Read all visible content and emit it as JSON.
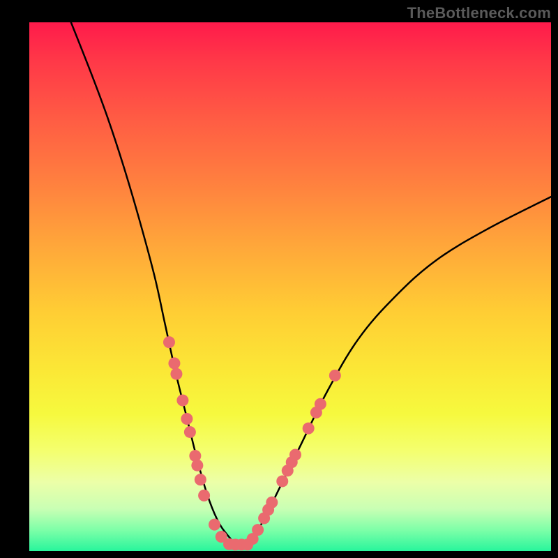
{
  "watermark": "TheBottleneck.com",
  "colors": {
    "background": "#000000",
    "curve": "#000000",
    "dot_fill": "#ea6a6f",
    "dot_stroke": "#d85a60"
  },
  "chart_data": {
    "type": "line",
    "title": "",
    "xlabel": "",
    "ylabel": "",
    "xlim": [
      0,
      100
    ],
    "ylim": [
      0,
      100
    ],
    "grid": false,
    "legend": false,
    "series": [
      {
        "name": "curve",
        "points": [
          [
            8,
            100
          ],
          [
            12,
            90
          ],
          [
            15,
            82
          ],
          [
            18,
            73
          ],
          [
            21,
            63
          ],
          [
            24,
            52
          ],
          [
            26,
            43
          ],
          [
            28,
            34
          ],
          [
            30,
            26
          ],
          [
            32,
            18
          ],
          [
            34,
            11
          ],
          [
            36,
            6
          ],
          [
            38,
            3
          ],
          [
            40,
            1.2
          ],
          [
            42,
            1.2
          ],
          [
            43,
            2.8
          ],
          [
            45,
            6
          ],
          [
            48,
            12
          ],
          [
            52,
            20
          ],
          [
            57,
            30
          ],
          [
            63,
            40
          ],
          [
            70,
            48
          ],
          [
            78,
            55
          ],
          [
            88,
            61
          ],
          [
            100,
            67
          ]
        ]
      }
    ],
    "dots": [
      [
        26.8,
        39.5
      ],
      [
        27.8,
        35.5
      ],
      [
        28.2,
        33.5
      ],
      [
        29.4,
        28.5
      ],
      [
        30.2,
        25.0
      ],
      [
        30.8,
        22.5
      ],
      [
        31.8,
        18.0
      ],
      [
        32.2,
        16.2
      ],
      [
        32.8,
        13.5
      ],
      [
        33.5,
        10.5
      ],
      [
        35.5,
        5.0
      ],
      [
        36.8,
        2.7
      ],
      [
        38.3,
        1.3
      ],
      [
        39.5,
        1.2
      ],
      [
        40.7,
        1.2
      ],
      [
        41.8,
        1.2
      ],
      [
        42.8,
        2.3
      ],
      [
        43.8,
        4.0
      ],
      [
        45.0,
        6.2
      ],
      [
        45.8,
        7.8
      ],
      [
        46.5,
        9.2
      ],
      [
        48.5,
        13.2
      ],
      [
        49.5,
        15.2
      ],
      [
        50.3,
        16.8
      ],
      [
        51.0,
        18.2
      ],
      [
        53.5,
        23.2
      ],
      [
        55.0,
        26.2
      ],
      [
        55.8,
        27.8
      ],
      [
        58.6,
        33.2
      ]
    ]
  }
}
